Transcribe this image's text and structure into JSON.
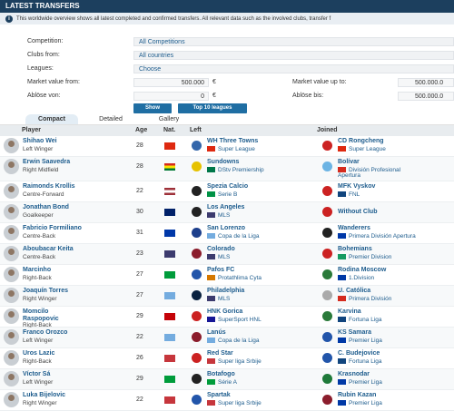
{
  "header": {
    "title": "LATEST TRANSFERS"
  },
  "info": {
    "text": "This worldwide overview shows all latest completed and confirmed transfers. All relevant data such as the involved clubs, transfer f"
  },
  "filters": {
    "competition_label": "Competition:",
    "competition_value": "All Competitions",
    "clubs_from_label": "Clubs from:",
    "clubs_from_value": "All countries",
    "leagues_label": "Leagues:",
    "leagues_value": "Choose",
    "mv_from_label": "Market value from:",
    "mv_from_value": "500.000",
    "mv_upto_label": "Market value up to:",
    "mv_upto_value": "500.000.0",
    "abl_von_label": "Ablöse von:",
    "abl_von_value": "0",
    "abl_bis_label": "Ablöse bis:",
    "abl_bis_value": "500.000.0",
    "currency": "€",
    "show_button": "Show",
    "top10_button": "Top 10 leagues"
  },
  "tabs": [
    "Compact",
    "Detailed",
    "Gallery"
  ],
  "columns": {
    "player": "Player",
    "age": "Age",
    "nat": "Nat.",
    "left": "Left",
    "joined": "Joined"
  },
  "colors": {
    "accent": "#1f6ea3",
    "header": "#1c3f5e",
    "link": "#1d5c8d"
  },
  "rows": [
    {
      "name": "Shihao Wei",
      "position": "Left Winger",
      "age": "28",
      "nat": [
        "#de2910"
      ],
      "left_club": "WH Three Towns",
      "left_league": "Super League",
      "left_flag": "#de2910",
      "left_crest": "#3366aa",
      "joined_club": "CD Rongcheng",
      "joined_league": "Super League",
      "joined_flag": "#de2910",
      "joined_crest": "#cc2222"
    },
    {
      "name": "Erwin Saavedra",
      "position": "Right Midfield",
      "age": "28",
      "nat": [
        "#d52b1e",
        "#f9e300",
        "#007934"
      ],
      "left_club": "Sundowns",
      "left_league": "DStv Premiership",
      "left_flag": "#007749",
      "left_crest": "#e6c200",
      "joined_club": "Bolívar",
      "joined_league": "División Profesional",
      "joined_league2": "Apertura",
      "joined_flag": "#d52b1e",
      "joined_crest": "#6cb4e4"
    },
    {
      "name": "Raimonds Krollis",
      "position": "Centre-Forward",
      "age": "22",
      "nat": [
        "#9e3039",
        "#ffffff",
        "#9e3039"
      ],
      "left_club": "Spezia Calcio",
      "left_league": "Serie B",
      "left_flag": "#009246",
      "left_crest": "#222222",
      "joined_club": "MFK Vyskov",
      "joined_league": "FNL",
      "joined_flag": "#11457e",
      "joined_crest": "#cc2222"
    },
    {
      "name": "Jonathan Bond",
      "position": "Goalkeeper",
      "age": "30",
      "nat": [
        "#012169"
      ],
      "left_club": "Los Angeles",
      "left_league": "MLS",
      "left_flag": "#3c3b6e",
      "left_crest": "#222222",
      "joined_club": "Without Club",
      "joined_league": "",
      "joined_flag": "",
      "joined_crest": "#cc2222"
    },
    {
      "name": "Fabricio Formiliano",
      "position": "Centre-Back",
      "age": "31",
      "nat": [
        "#0038a8"
      ],
      "left_club": "San Lorenzo",
      "left_league": "Copa de la Liga",
      "left_flag": "#74acdf",
      "left_crest": "#1d3f8c",
      "joined_club": "Wanderers",
      "joined_league": "Primera División Apertura",
      "joined_flag": "#0038a8",
      "joined_crest": "#222222"
    },
    {
      "name": "Aboubacar Keita",
      "position": "Centre-Back",
      "age": "23",
      "nat": [
        "#3c3b6e"
      ],
      "left_club": "Colorado",
      "left_league": "MLS",
      "left_flag": "#3c3b6e",
      "left_crest": "#8b1d2c",
      "joined_club": "Bohemians",
      "joined_league": "Premier Division",
      "joined_flag": "#169b62",
      "joined_crest": "#cc2222"
    },
    {
      "name": "Marcinho",
      "position": "Right-Back",
      "age": "27",
      "nat": [
        "#009c3b"
      ],
      "left_club": "Pafos FC",
      "left_league": "Protathlima Cyta",
      "left_flag": "#d57800",
      "left_crest": "#2255aa",
      "joined_club": "Rodina Moscow",
      "joined_league": "1.Division",
      "joined_flag": "#0039a6",
      "joined_crest": "#2a7a3a"
    },
    {
      "name": "Joaquín Torres",
      "position": "Right Winger",
      "age": "27",
      "nat": [
        "#74acdf"
      ],
      "left_club": "Philadelphia",
      "left_league": "MLS",
      "left_flag": "#3c3b6e",
      "left_crest": "#0a2240",
      "joined_club": "U. Católica",
      "joined_league": "Primera División",
      "joined_flag": "#d52b1e",
      "joined_crest": "#aaaaaa"
    },
    {
      "name": "Momcilo",
      "name2": "Raspopovic",
      "position": "Right-Back",
      "age": "29",
      "nat": [
        "#c40308"
      ],
      "left_club": "HNK Gorica",
      "left_league": "SuperSport HNL",
      "left_flag": "#171796",
      "left_crest": "#cc2222",
      "joined_club": "Karvina",
      "joined_league": "Fortuna Liga",
      "joined_flag": "#11457e",
      "joined_crest": "#2a7a3a"
    },
    {
      "name": "Franco Orozco",
      "position": "Left Winger",
      "age": "22",
      "nat": [
        "#74acdf"
      ],
      "left_club": "Lanús",
      "left_league": "Copa de la Liga",
      "left_flag": "#74acdf",
      "left_crest": "#8b1d2c",
      "joined_club": "KS Samara",
      "joined_league": "Premier Liga",
      "joined_flag": "#0039a6",
      "joined_crest": "#2255aa"
    },
    {
      "name": "Uros Lazic",
      "position": "Right-Back",
      "age": "26",
      "nat": [
        "#c6363c"
      ],
      "left_club": "Red Star",
      "left_league": "Super liga Srbije",
      "left_flag": "#c6363c",
      "left_crest": "#cc2222",
      "joined_club": "C. Budejovice",
      "joined_league": "Fortuna Liga",
      "joined_flag": "#11457e",
      "joined_crest": "#2255aa"
    },
    {
      "name": "Víctor Sá",
      "position": "Left Winger",
      "age": "29",
      "nat": [
        "#009c3b"
      ],
      "left_club": "Botafogo",
      "left_league": "Série A",
      "left_flag": "#009c3b",
      "left_crest": "#222222",
      "joined_club": "Krasnodar",
      "joined_league": "Premier Liga",
      "joined_flag": "#0039a6",
      "joined_crest": "#1f7a3a"
    },
    {
      "name": "Luka Bijelovic",
      "position": "Right Winger",
      "age": "22",
      "nat": [
        "#c6363c"
      ],
      "left_club": "Spartak",
      "left_league": "Super liga Srbije",
      "left_flag": "#c6363c",
      "left_crest": "#2255aa",
      "joined_club": "Rubin Kazan",
      "joined_league": "Premier Liga",
      "joined_flag": "#0039a6",
      "joined_crest": "#8b1d2c"
    }
  ]
}
